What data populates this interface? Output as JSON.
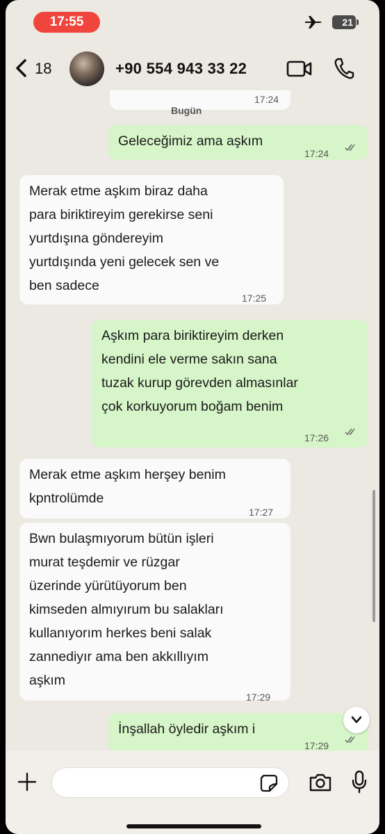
{
  "status_bar": {
    "time": "17:55",
    "battery": "21"
  },
  "header": {
    "back_count": "18",
    "contact": "+90 554 943 33 22"
  },
  "chat": {
    "previous_time": "17:24",
    "date_label": "Bugün",
    "messages": [
      {
        "direction": "out",
        "lines": [
          "Geleceğimiz ama aşkım"
        ],
        "time": "17:24",
        "read": true
      },
      {
        "direction": "in",
        "lines": [
          "Merak etme aşkım biraz daha",
          "para biriktireyim gerekirse seni",
          "yurtdışına göndereyim",
          "yurtdışında yeni gelecek sen ve",
          "ben sadece"
        ],
        "time": "17:25"
      },
      {
        "direction": "out",
        "lines": [
          "Aşkım para biriktireyim derken",
          "kendini ele verme sakın sana",
          "tuzak kurup görevden almasınlar",
          "çok korkuyorum  boğam benim"
        ],
        "time": "17:26",
        "read": true
      },
      {
        "direction": "in",
        "lines": [
          "Merak etme aşkım herşey benim",
          "kpntrolümde"
        ],
        "time": "17:27"
      },
      {
        "direction": "in",
        "lines": [
          "Bwn bulaşmıyorum bütün işleri",
          "murat teşdemir ve rüzgar",
          "üzerinde yürütüyorum ben",
          "kimseden almıyırum bu salakları",
          "kullanıyorım herkes beni salak",
          "zannediyır ama ben akkıllıyım",
          "aşkım"
        ],
        "time": "17:29"
      },
      {
        "direction": "out",
        "lines": [
          "İnşallah öyledir aşkım i"
        ],
        "time": "17:29",
        "read": true
      }
    ]
  },
  "colors": {
    "incoming": "#fafafa",
    "outgoing": "#d6f5c8",
    "time_pill": "#f0453c",
    "background": "#ece8e2"
  },
  "icons": [
    "back-chevron-icon",
    "video-call-icon",
    "phone-icon",
    "plus-icon",
    "sticker-icon",
    "camera-icon",
    "microphone-icon",
    "chevron-down-icon",
    "airplane-icon"
  ]
}
